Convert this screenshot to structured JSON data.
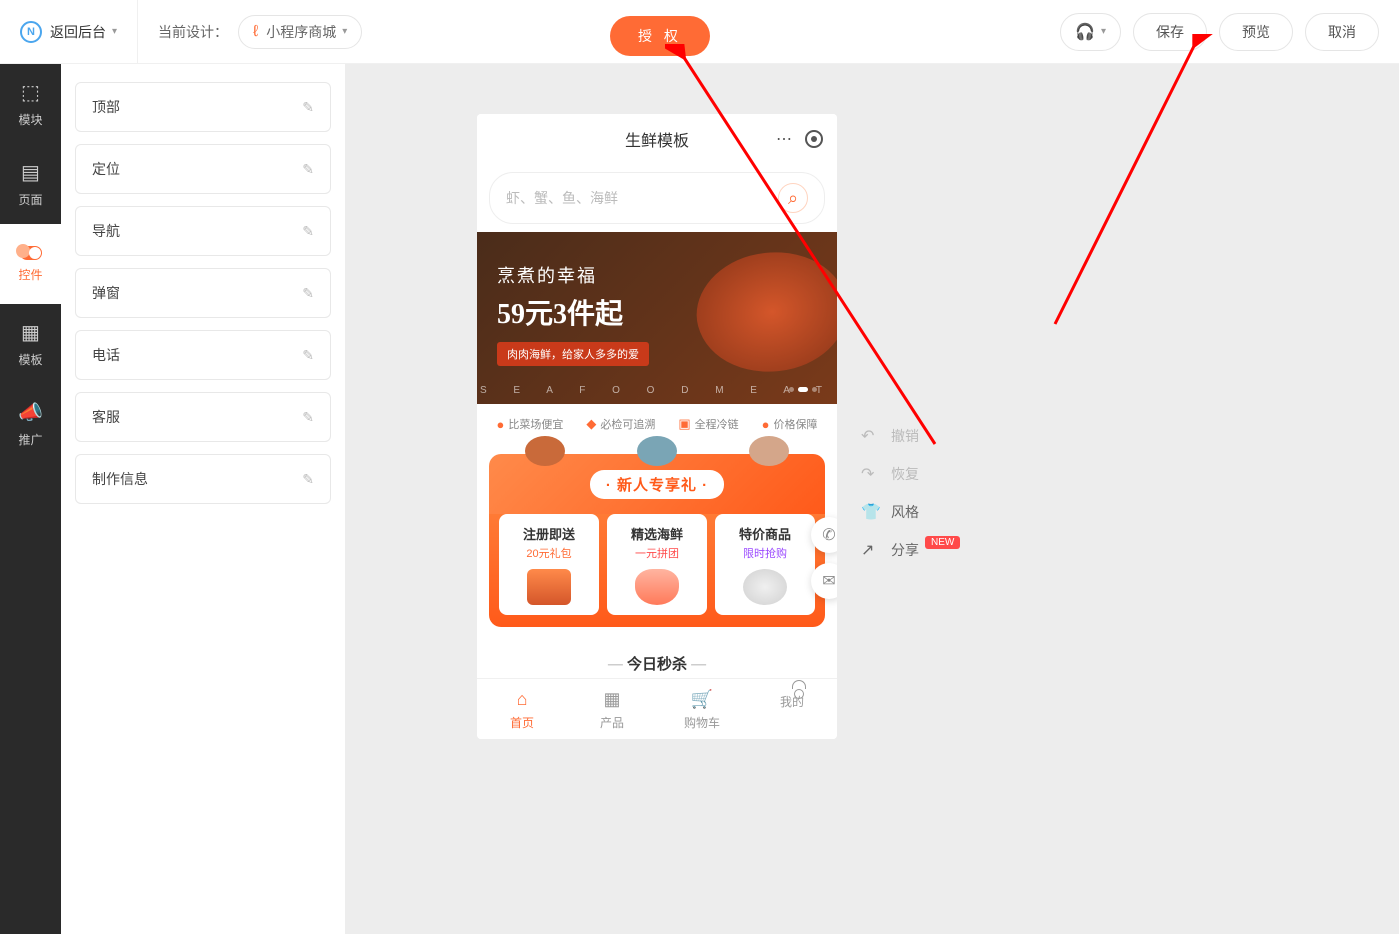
{
  "topbar": {
    "back": "返回后台",
    "current_design_label": "当前设计：",
    "design_name": "小程序商城",
    "auth": "授 权",
    "save": "保存",
    "preview": "预览",
    "cancel": "取消"
  },
  "sidebar": {
    "items": [
      {
        "label": "模块"
      },
      {
        "label": "页面"
      },
      {
        "label": "控件"
      },
      {
        "label": "模板"
      },
      {
        "label": "推广"
      }
    ]
  },
  "components": {
    "items": [
      {
        "label": "顶部"
      },
      {
        "label": "定位"
      },
      {
        "label": "导航"
      },
      {
        "label": "弹窗"
      },
      {
        "label": "电话"
      },
      {
        "label": "客服"
      },
      {
        "label": "制作信息"
      }
    ]
  },
  "phone": {
    "title": "生鲜模板",
    "search_placeholder": "虾、蟹、鱼、海鲜",
    "banner": {
      "line1": "烹煮的幸福",
      "line2": "59元3件起",
      "tag": "肉肉海鲜，给家人多多的爱",
      "letters": "S E A F O O D   M E A T"
    },
    "features": [
      {
        "label": "比菜场便宜"
      },
      {
        "label": "必检可追溯"
      },
      {
        "label": "全程冷链"
      },
      {
        "label": "价格保障"
      }
    ],
    "newcomer": {
      "title": "· 新人专享礼 ·",
      "cards": [
        {
          "title": "注册即送",
          "sub": "20元礼包"
        },
        {
          "title": "精选海鲜",
          "sub": "一元拼团"
        },
        {
          "title": "特价商品",
          "sub": "限时抢购"
        }
      ]
    },
    "flash_sale": "今日秒杀",
    "tabs": [
      {
        "label": "首页"
      },
      {
        "label": "产品"
      },
      {
        "label": "购物车"
      },
      {
        "label": "我的"
      }
    ]
  },
  "right_actions": {
    "undo": "撤销",
    "redo": "恢复",
    "style": "风格",
    "share": "分享",
    "new_badge": "NEW"
  }
}
